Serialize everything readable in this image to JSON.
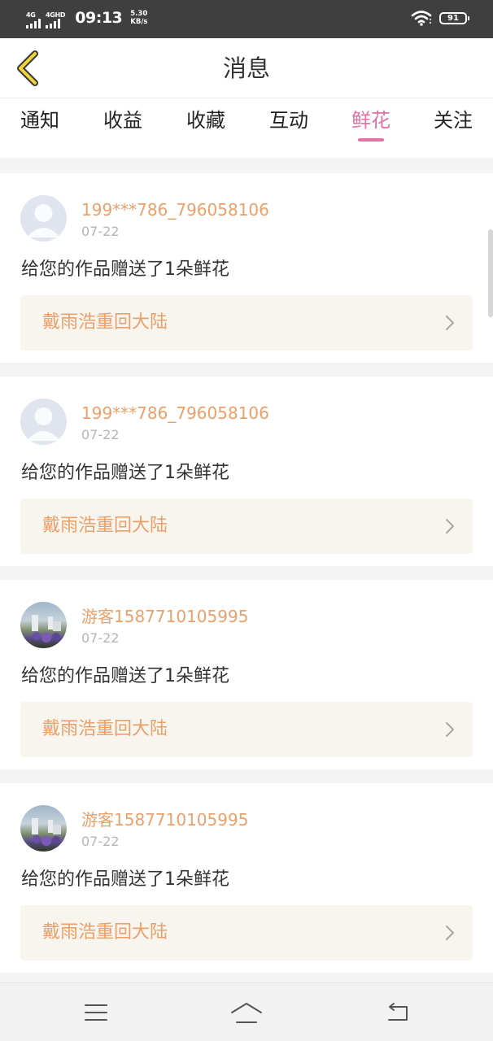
{
  "status_bar": {
    "net1": "4G",
    "net2": "4GHD",
    "time": "09:13",
    "speed_value": "5.30",
    "speed_unit": "KB/s",
    "battery": "91"
  },
  "header": {
    "title": "消息",
    "back_icon": "chevron-left-icon"
  },
  "tabs": [
    {
      "label": "通知",
      "active": false
    },
    {
      "label": "收益",
      "active": false
    },
    {
      "label": "收藏",
      "active": false
    },
    {
      "label": "互动",
      "active": false
    },
    {
      "label": "鲜花",
      "active": true
    },
    {
      "label": "关注",
      "active": false
    }
  ],
  "colors": {
    "accent": "#e070a6",
    "username": "#eaa06a",
    "work_bg": "#f7f5ee"
  },
  "messages": [
    {
      "username": "199***786_796058106",
      "date": "07-22",
      "text": "给您的作品赠送了1朵鲜花",
      "work_title": "戴雨浩重回大陆",
      "avatar": "default-avatar"
    },
    {
      "username": "199***786_796058106",
      "date": "07-22",
      "text": "给您的作品赠送了1朵鲜花",
      "work_title": "戴雨浩重回大陆",
      "avatar": "default-avatar"
    },
    {
      "username": "游客1587710105995",
      "date": "07-22",
      "text": "给您的作品赠送了1朵鲜花",
      "work_title": "戴雨浩重回大陆",
      "avatar": "photo-avatar"
    },
    {
      "username": "游客1587710105995",
      "date": "07-22",
      "text": "给您的作品赠送了1朵鲜花",
      "work_title": "戴雨浩重回大陆",
      "avatar": "photo-avatar"
    }
  ],
  "nav_bar": {
    "icons": [
      "menu-icon",
      "home-icon",
      "back-icon"
    ]
  }
}
